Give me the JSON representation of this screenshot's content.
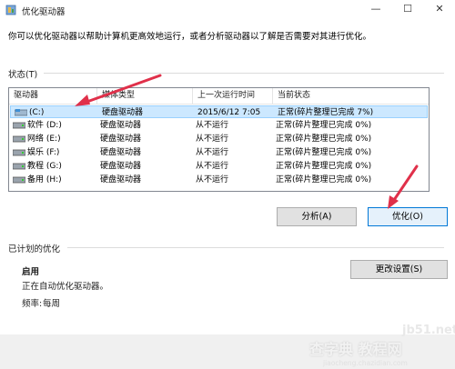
{
  "window": {
    "title": "优化驱动器",
    "minimize": "—",
    "maximize": "☐",
    "close": "✕"
  },
  "intro": "你可以优化驱动器以帮助计算机更高效地运行，或者分析驱动器以了解是否需要对其进行优化。",
  "status_section": {
    "label": "状态(T)"
  },
  "drive_list": {
    "columns": [
      "驱动器",
      "媒体类型",
      "上一次运行时间",
      "当前状态"
    ],
    "rows": [
      {
        "drive": "(C:)",
        "media": "硬盘驱动器",
        "last_run": "2015/6/12 7:05",
        "status": "正常(碎片整理已完成 7%)",
        "selected": true
      },
      {
        "drive": "软件 (D:)",
        "media": "硬盘驱动器",
        "last_run": "从不运行",
        "status": "正常(碎片整理已完成 0%)",
        "selected": false
      },
      {
        "drive": "网络 (E:)",
        "media": "硬盘驱动器",
        "last_run": "从不运行",
        "status": "正常(碎片整理已完成 0%)",
        "selected": false
      },
      {
        "drive": "娱乐 (F:)",
        "media": "硬盘驱动器",
        "last_run": "从不运行",
        "status": "正常(碎片整理已完成 0%)",
        "selected": false
      },
      {
        "drive": "教程 (G:)",
        "media": "硬盘驱动器",
        "last_run": "从不运行",
        "status": "正常(碎片整理已完成 0%)",
        "selected": false
      },
      {
        "drive": "备用 (H:)",
        "media": "硬盘驱动器",
        "last_run": "从不运行",
        "status": "正常(碎片整理已完成 0%)",
        "selected": false
      }
    ]
  },
  "buttons": {
    "analyze": "分析(A)",
    "optimize": "优化(O)",
    "change_settings": "更改设置(S)"
  },
  "scheduled": {
    "label": "已计划的优化",
    "state": "启用",
    "description": "正在自动优化驱动器。",
    "frequency_label": "频率:",
    "frequency_value": "每周"
  },
  "watermark": {
    "site": "jb51.net",
    "brand": "查字典 教程网",
    "url": "jiaocheng.chazidian.com"
  },
  "colors": {
    "selection": "#cce8ff",
    "annotation_arrow": "#e0304a",
    "accent": "#0078d7"
  }
}
